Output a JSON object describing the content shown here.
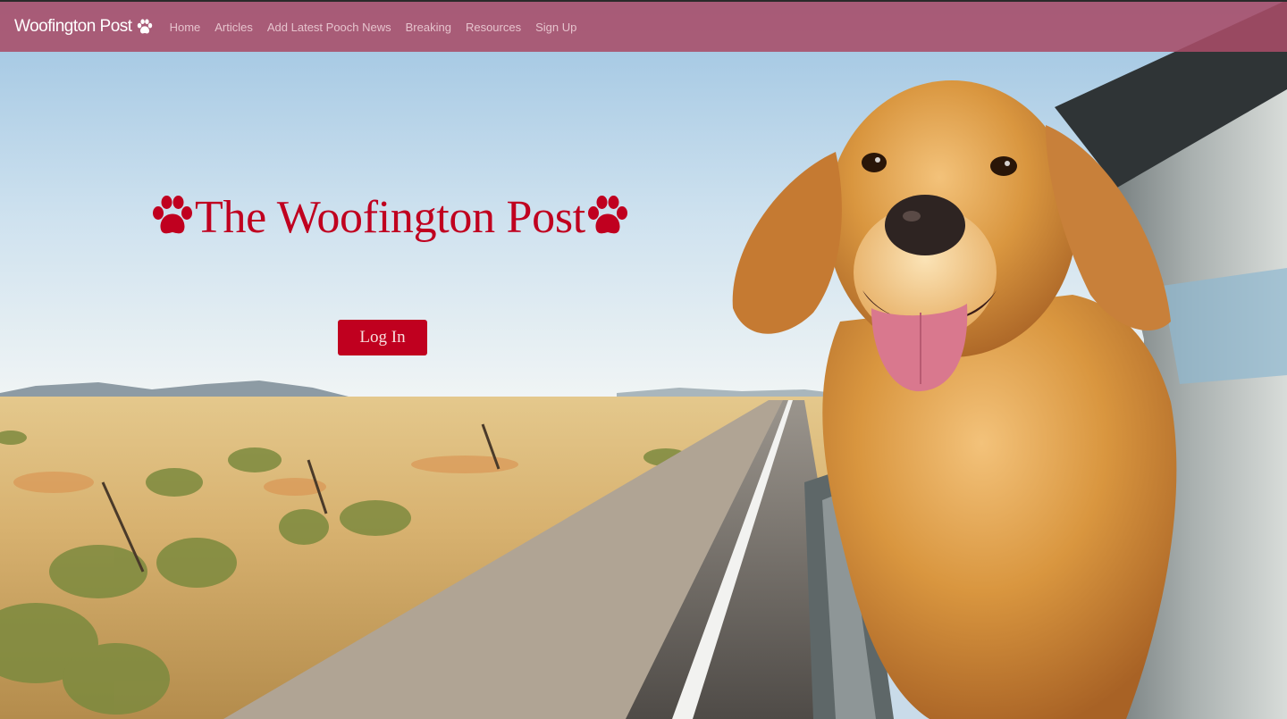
{
  "navbar": {
    "brand": "Woofington Post",
    "brand_icon": "paw-icon",
    "links": [
      "Home",
      "Articles",
      "Add Latest Pooch News",
      "Breaking",
      "Resources",
      "Sign Up"
    ]
  },
  "hero": {
    "title": "The Woofington Post",
    "title_icon": "paw-icon",
    "login_label": "Log In",
    "image": "dog-in-car-window-on-desert-road"
  },
  "colors": {
    "navbar": "#a84c68",
    "accent_red": "#c0001f",
    "nav_link": "#e6c3cd"
  }
}
